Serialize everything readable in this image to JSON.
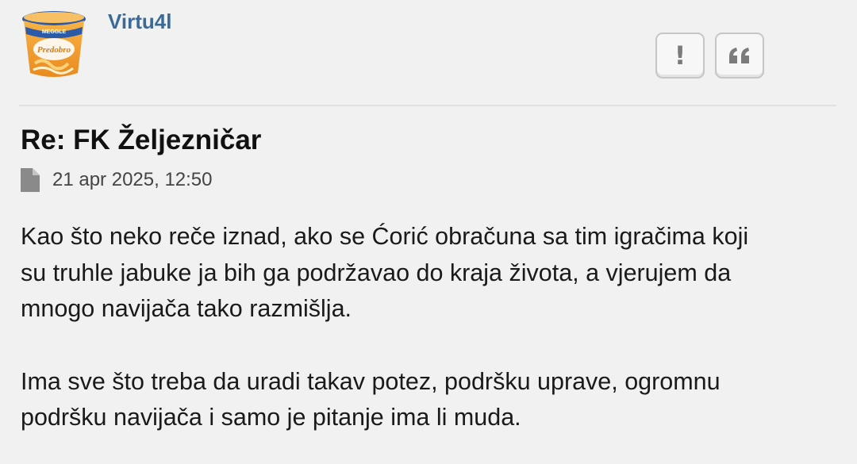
{
  "post": {
    "author": "Virtu4l",
    "avatar_text": {
      "brand": "MEGGLE",
      "product": "Predobro"
    },
    "actions": {
      "report_icon": "exclamation-icon",
      "quote_icon": "quote-icon"
    },
    "title": "Re: FK Željezničar",
    "date_icon": "file-icon",
    "date": "21 apr 2025, 12:50",
    "paragraphs": [
      "Kao što neko reče iznad, ako se Ćorić obračuna sa tim igračima koji\nsu truhle jabuke ja bih ga podržavao do kraja života, a vjerujem da\nmnogo navijača tako razmišlja.",
      "Ima sve što treba da uradi takav potez, podršku uprave, ogromnu\npodršku navijača i samo je pitanje ima li muda."
    ]
  },
  "colors": {
    "background": "#f1f1f1",
    "username": "#3b6a99",
    "button_icon": "#7b7b7b",
    "avatar_orange": "#f0a030",
    "avatar_blue": "#2a5aa8"
  }
}
